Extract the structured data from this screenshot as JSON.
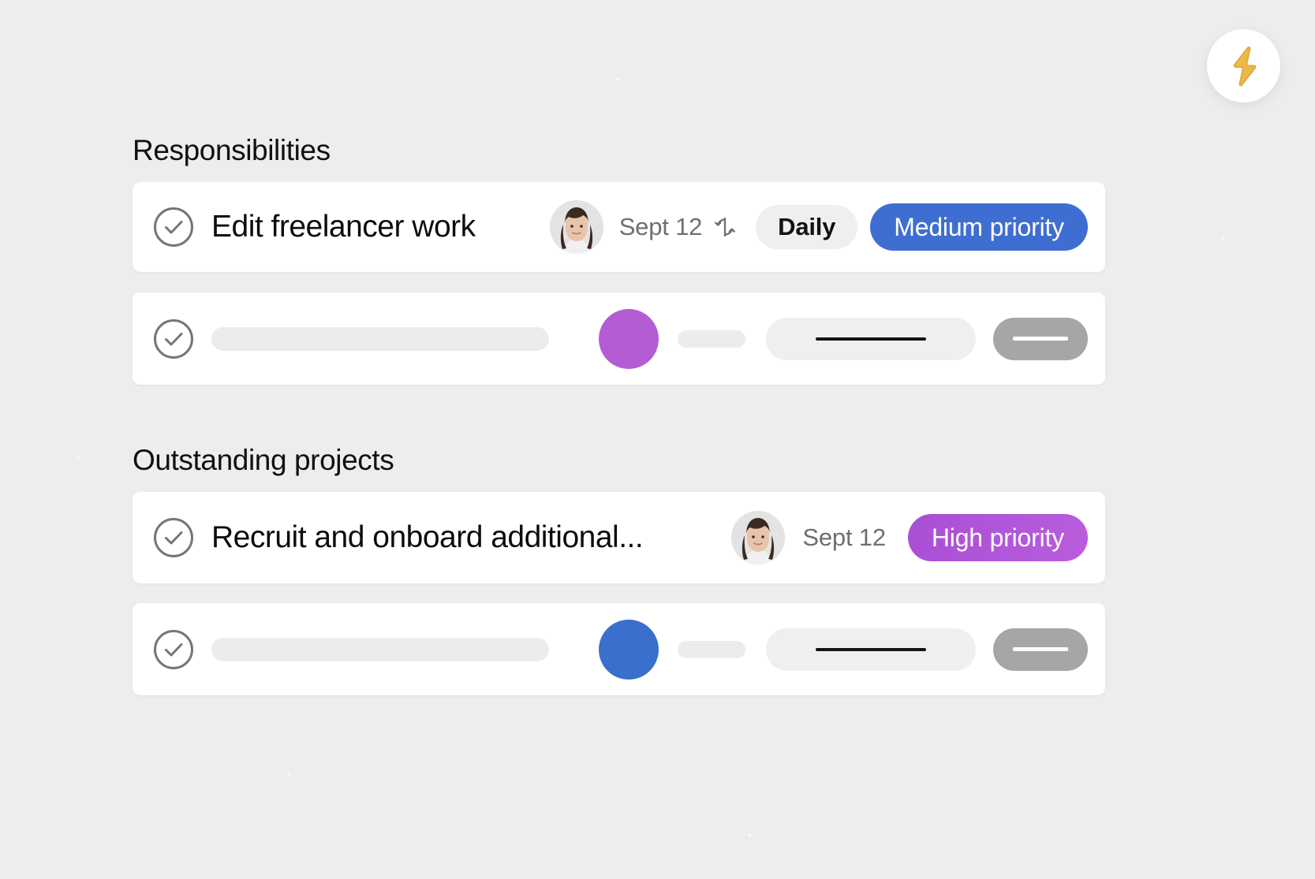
{
  "badge": {
    "icon": "lightning-bolt-icon",
    "color": "#eab94a",
    "background": "#ffffff"
  },
  "sections": [
    {
      "id": "responsibilities",
      "title": "Responsibilities",
      "task": {
        "checkbox_icon": "check-circle-icon",
        "title": "Edit freelancer work",
        "avatar_icon": "user-avatar",
        "date": "Sept 12",
        "repeat_icon": "repeat-icon",
        "recurrence": "Daily",
        "priority": "Medium priority",
        "priority_color": "#3f6ed2"
      },
      "placeholder": {
        "checkbox_icon": "check-circle-icon",
        "dot_color": "#b35cd4"
      }
    },
    {
      "id": "outstanding",
      "title": "Outstanding projects",
      "task": {
        "checkbox_icon": "check-circle-icon",
        "title": "Recruit and onboard additional...",
        "avatar_icon": "user-avatar",
        "date": "Sept 12",
        "priority": "High priority",
        "priority_color": "#b055d8"
      },
      "placeholder": {
        "checkbox_icon": "check-circle-icon",
        "dot_color": "#3a6fcc"
      }
    }
  ]
}
